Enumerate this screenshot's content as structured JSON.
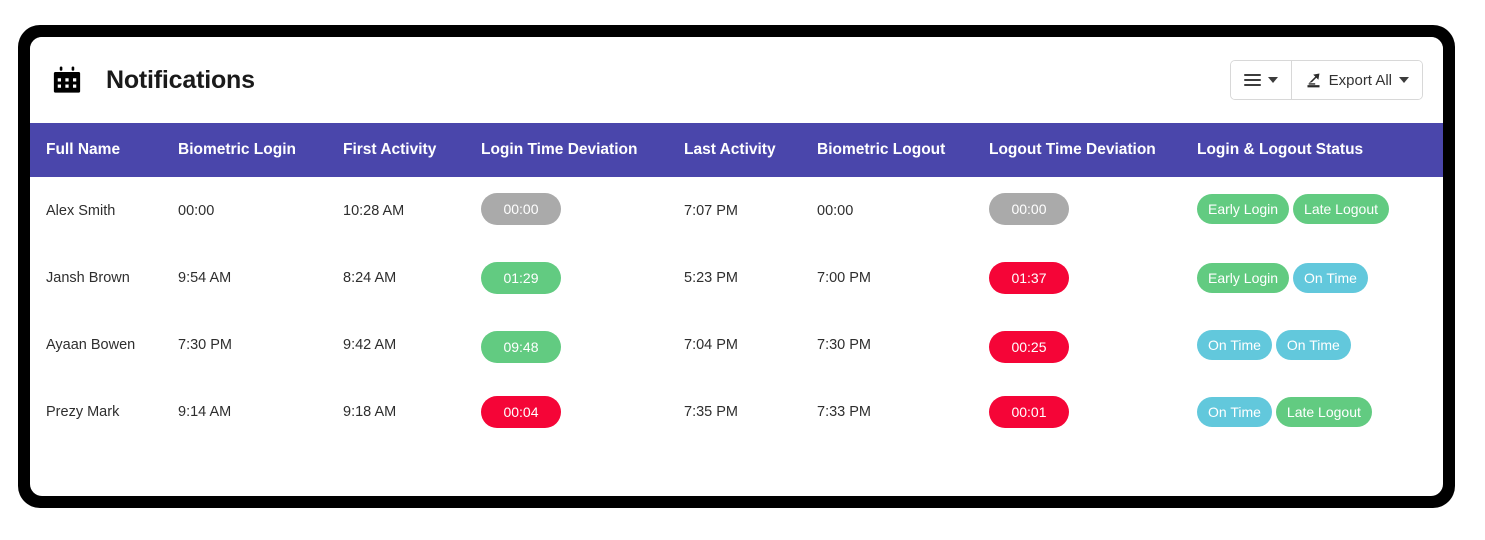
{
  "header": {
    "title": "Notifications",
    "calendar_icon": "calendar-icon",
    "buttons": {
      "column_toggle": {
        "icon": "list-icon",
        "label": ""
      },
      "export": {
        "icon": "export-icon",
        "label": "Export All"
      }
    }
  },
  "colors": {
    "table_header_bg": "#4a46ab",
    "green": "#62cb81",
    "red": "#f50537",
    "cyan": "#62c8dc",
    "grey": "#aaaaaa",
    "card_bg": "#ffffff",
    "frame": "#000000"
  },
  "table": {
    "columns": [
      "Full Name",
      "Biometric Login",
      "First Activity",
      "Login Time Deviation",
      "Last Activity",
      "Biometric Logout",
      "Logout Time Deviation",
      "Login & Logout Status"
    ],
    "rows": [
      {
        "full_name": "Alex Smith",
        "biometric_login": "00:00",
        "first_activity": "10:28 AM",
        "login_deviation": {
          "value": "00:00",
          "color": "grey"
        },
        "last_activity": "7:07 PM",
        "biometric_logout": "00:00",
        "logout_deviation": {
          "value": "00:00",
          "color": "grey"
        },
        "status": [
          {
            "label": "Early Login",
            "color": "green"
          },
          {
            "label": "Late Logout",
            "color": "green"
          }
        ]
      },
      {
        "full_name": "Jansh Brown",
        "biometric_login": "9:54 AM",
        "first_activity": "8:24 AM",
        "login_deviation": {
          "value": "01:29",
          "color": "green"
        },
        "last_activity": "5:23 PM",
        "biometric_logout": "7:00 PM",
        "logout_deviation": {
          "value": "01:37",
          "color": "red"
        },
        "status": [
          {
            "label": "Early Login",
            "color": "green"
          },
          {
            "label": "On Time",
            "color": "cyan"
          }
        ]
      },
      {
        "full_name": "Ayaan Bowen",
        "biometric_login": "7:30 PM",
        "first_activity": "9:42 AM",
        "login_deviation": {
          "value": "09:48",
          "color": "green"
        },
        "last_activity": "7:04 PM",
        "biometric_logout": "7:30 PM",
        "logout_deviation": {
          "value": "00:25",
          "color": "red"
        },
        "status": [
          {
            "label": "On Time",
            "color": "cyan"
          },
          {
            "label": "On Time",
            "color": "cyan"
          }
        ]
      },
      {
        "full_name": "Prezy Mark",
        "biometric_login": "9:14 AM",
        "first_activity": "9:18 AM",
        "login_deviation": {
          "value": "00:04",
          "color": "red"
        },
        "last_activity": "7:35 PM",
        "biometric_logout": "7:33 PM",
        "logout_deviation": {
          "value": "00:01",
          "color": "red"
        },
        "status": [
          {
            "label": "On Time",
            "color": "cyan"
          },
          {
            "label": "Late Logout",
            "color": "green"
          }
        ]
      }
    ]
  }
}
